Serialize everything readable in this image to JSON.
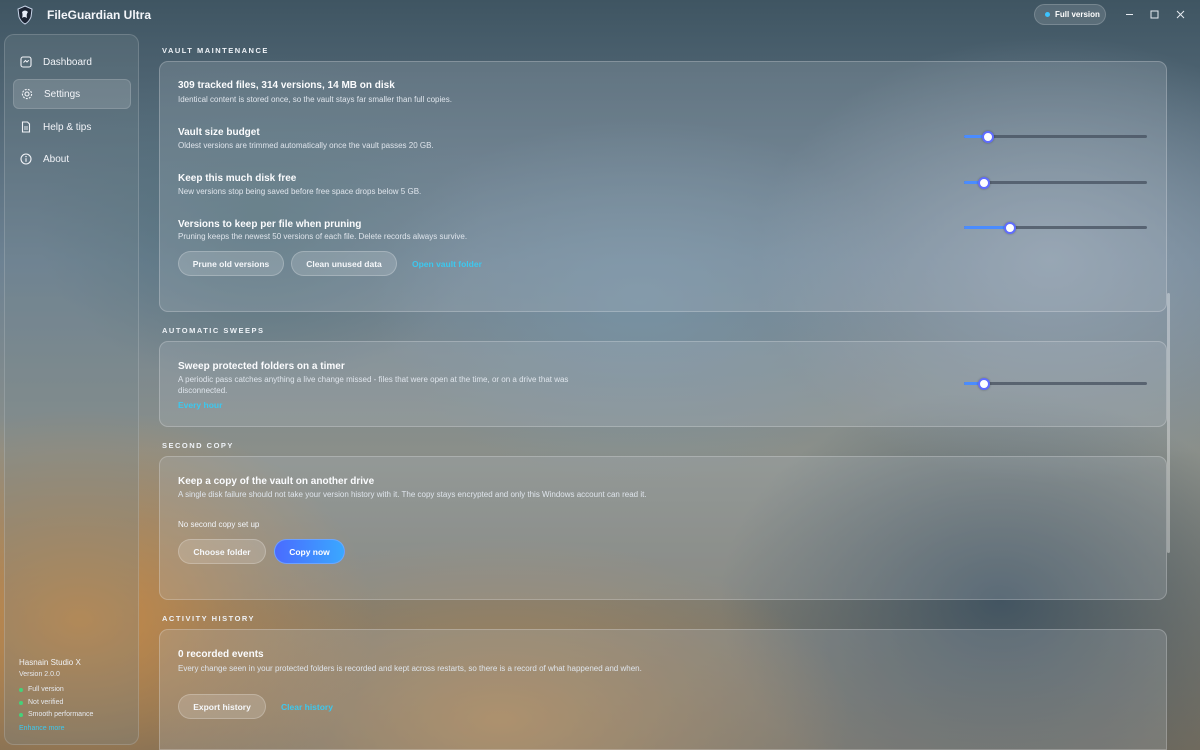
{
  "app": {
    "title": "FileGuardian Ultra",
    "version_pill": "Full version",
    "window_controls": {
      "minimize": "—",
      "maximize": "☐",
      "close": "✕"
    }
  },
  "sidebar": {
    "items": [
      {
        "label": "Dashboard",
        "icon": "dashboard-icon",
        "active": false
      },
      {
        "label": "Settings",
        "icon": "gear-icon",
        "active": true
      },
      {
        "label": "Help & tips",
        "icon": "document-icon",
        "active": false
      },
      {
        "label": "About",
        "icon": "info-icon",
        "active": false
      }
    ],
    "studio": "Hasnain Studio X",
    "version": "Version 2.0.0",
    "status": [
      "Full version",
      "Not verified",
      "Smooth performance"
    ],
    "status_link": "Enhance more"
  },
  "sections": {
    "vault": {
      "heading": "VAULT MAINTENANCE",
      "summary_title": "309 tracked files, 314 versions, 14 MB on disk",
      "summary_sub": "Identical content is stored once, so the vault stays far smaller than full copies.",
      "size_budget_title": "Vault size budget",
      "size_budget_sub": "Oldest versions are trimmed automatically once the vault passes 20 GB.",
      "size_budget_fraction": 0.13,
      "disk_free_title": "Keep this much disk free",
      "disk_free_sub": "New versions stop being saved before free space drops below 5 GB.",
      "disk_free_fraction": 0.11,
      "versions_title": "Versions to keep per file when pruning",
      "versions_sub": "Pruning keeps the newest 50 versions of each file. Delete records always survive.",
      "versions_fraction": 0.25,
      "prune_button": "Prune old versions",
      "clean_button": "Clean unused data",
      "open_link": "Open vault folder"
    },
    "sweeps": {
      "heading": "AUTOMATIC SWEEPS",
      "title": "Sweep protected folders on a timer",
      "sub": "A periodic pass catches anything a live change missed - files that were open at the time, or on a drive that was disconnected.",
      "value": "Every hour",
      "fraction": 0.11
    },
    "second_copy": {
      "heading": "SECOND COPY",
      "title": "Keep a copy of the vault on another drive",
      "sub": "A single disk failure should not take your version history with it. The copy stays encrypted and only this Windows account can read it.",
      "status": "No second copy set up",
      "choose_button": "Choose folder",
      "copy_button": "Copy now"
    },
    "activity": {
      "heading": "ACTIVITY HISTORY",
      "title": "0 recorded events",
      "sub": "Every change seen in your protected folders is recorded and kept across restarts, so there is a record of what happened and when.",
      "export_button": "Export history",
      "clear_link": "Clear history"
    }
  },
  "colors": {
    "accent": "#3cc8ef",
    "primary_button_start": "#4a6bff",
    "primary_button_end": "#3aa8ff",
    "slider_fill": "#4a8cff",
    "status_ok": "#45d27a"
  }
}
